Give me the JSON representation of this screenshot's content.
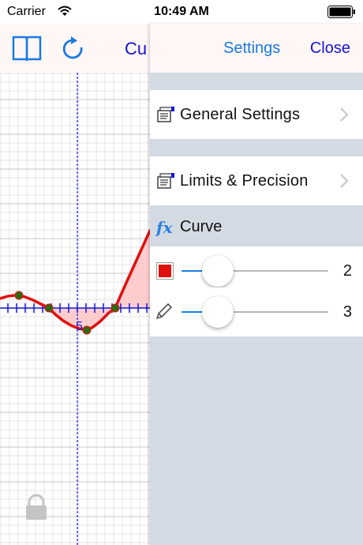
{
  "status_bar": {
    "carrier": "Carrier",
    "time": "10:49 AM"
  },
  "graph_nav": {
    "title": "Cu",
    "icons": [
      "book-icon",
      "refresh-icon"
    ],
    "accent_color": "#1a7ae0"
  },
  "graph": {
    "axis_label": "5",
    "curve_color": "#e01010",
    "fill_color": "#ffc8c8",
    "point_color": "#2e6b10",
    "axis_color": "#1414d8"
  },
  "settings_panel": {
    "header": {
      "title": "Settings",
      "close_label": "Close"
    },
    "items": [
      {
        "label": "General Settings",
        "icon": "settings-icon"
      },
      {
        "label": "Limits & Precision",
        "icon": "settings-icon"
      }
    ],
    "curve_section": {
      "icon": "fx-icon",
      "label": "Curve",
      "color_slider": {
        "value": "2",
        "fraction": 0.18,
        "swatch_color": "#e01010"
      },
      "width_slider": {
        "value": "3",
        "fraction": 0.18
      }
    }
  }
}
